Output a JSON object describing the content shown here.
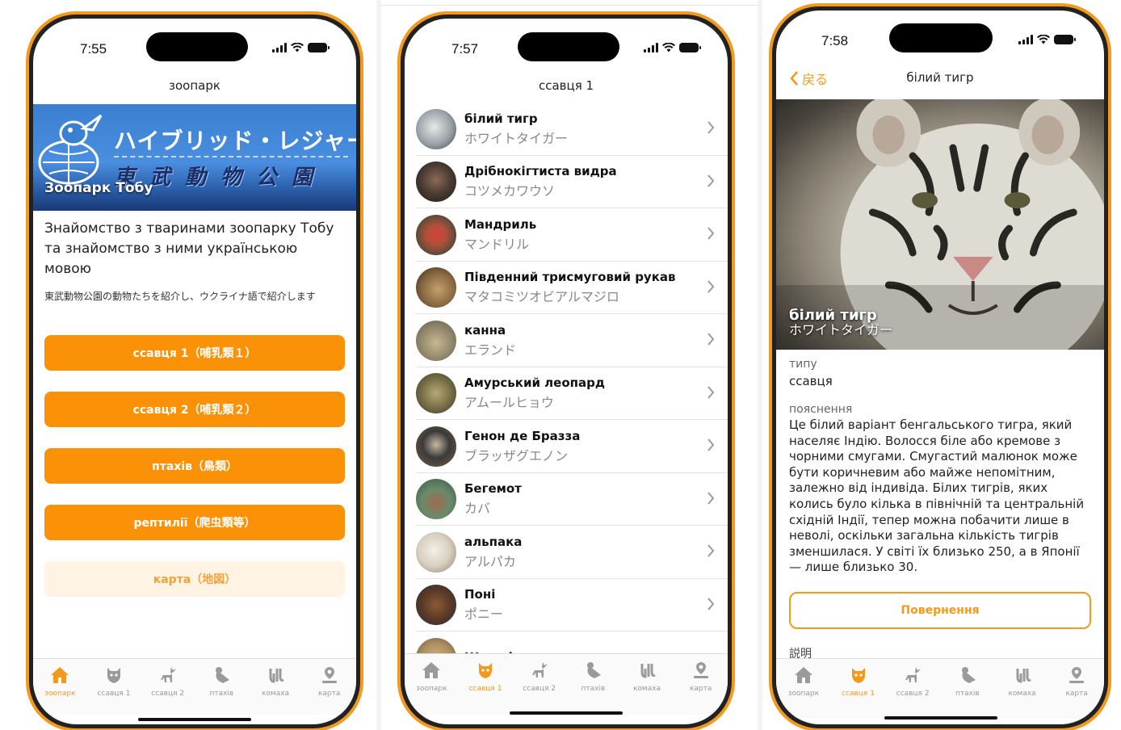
{
  "colors": {
    "accent": "#F39A1E",
    "button": "#FB9106",
    "button_disabled_bg": "#FFF4E3"
  },
  "phone1": {
    "time": "7:55",
    "nav_title": "зоопарк",
    "banner": {
      "jp_line1": "ハイブリッド・レジャーランド",
      "jp_line2": "東武動物公園",
      "caption": "Зоопарк Тобу"
    },
    "intro_uk": "Знайомство з тваринами зоопарку Тобу та знайомство з ними українською мовою",
    "intro_jp": "東武動物公園の動物たちを紹介し、ウクライナ語で紹介します",
    "buttons": [
      {
        "label": "ссавця 1（哺乳類１）"
      },
      {
        "label": "ссавця 2（哺乳類２）"
      },
      {
        "label": "птахів（鳥類）"
      },
      {
        "label": "рептилії（爬虫類等）"
      },
      {
        "label": "карта（地図）"
      }
    ],
    "tabs": [
      {
        "label": "зоопарк",
        "icon": "home-icon",
        "active": true
      },
      {
        "label": "ссавця 1",
        "icon": "mammal-icon",
        "active": false
      },
      {
        "label": "ссавця 2",
        "icon": "deer-icon",
        "active": false
      },
      {
        "label": "птахів",
        "icon": "bird-icon",
        "active": false
      },
      {
        "label": "комаха",
        "icon": "insect-icon",
        "active": false
      },
      {
        "label": "карта",
        "icon": "map-pin-icon",
        "active": false
      }
    ]
  },
  "phone2": {
    "time": "7:57",
    "nav_title": "ссавця 1",
    "animals": [
      {
        "name": "білий тигр",
        "jp": "ホワイトタイガー",
        "color": "#9aa1a6"
      },
      {
        "name": "Дрібнокігтиста видра",
        "jp": "コツメカワウソ",
        "color": "#4a3a32"
      },
      {
        "name": "Мандриль",
        "jp": "マンドリル",
        "color": "#b0503a"
      },
      {
        "name": "Південний трисмуговий рукав",
        "jp": "マタコミツオビアルマジロ",
        "color": "#8a6a44"
      },
      {
        "name": "канна",
        "jp": "エランド",
        "color": "#9a8e72"
      },
      {
        "name": "Амурський леопард",
        "jp": "アムールヒョウ",
        "color": "#7a7048"
      },
      {
        "name": "Генон де Бразза",
        "jp": "ブラッザグエノン",
        "color": "#3a3a3a"
      },
      {
        "name": "Бегемот",
        "jp": "カバ",
        "color": "#6a8a6a"
      },
      {
        "name": "альпака",
        "jp": "アルパカ",
        "color": "#d8d0c0"
      },
      {
        "name": "Поні",
        "jp": "ポニー",
        "color": "#5a3a26"
      },
      {
        "name": "Жираф",
        "jp": "",
        "color": "#b09060"
      }
    ],
    "tabs": [
      {
        "label": "зоопарк",
        "icon": "home-icon",
        "active": false
      },
      {
        "label": "ссавця 1",
        "icon": "mammal-icon",
        "active": true
      },
      {
        "label": "ссавця 2",
        "icon": "deer-icon",
        "active": false
      },
      {
        "label": "птахів",
        "icon": "bird-icon",
        "active": false
      },
      {
        "label": "комаха",
        "icon": "insect-icon",
        "active": false
      },
      {
        "label": "карта",
        "icon": "map-pin-icon",
        "active": false
      }
    ]
  },
  "phone3": {
    "time": "7:58",
    "back_label": "戻る",
    "nav_title": "білий тигр",
    "hero_title": "білий тигр",
    "hero_sub": "ホワイトタイガー",
    "type_label": "типу",
    "type_value": "ссавця",
    "desc_label": "пояснення",
    "description": "Це білий варіант бенгальського тигра, який населяє Індію. Волосся біле або кремове з чорними смугами. Смугастий малюнок може бути коричневим або майже непомітним, залежно від індивіда. Білих тигрів, яких колись було кілька в північній та центральній східній Індії, тепер можна побачити лише в неволі, оскільки загальна кількість тигрів зменшилася. У світі їх близько 250, а в Японії — лише близько 30.",
    "return_button": "Повернення",
    "jp_label": "説明",
    "tabs": [
      {
        "label": "зоопарк",
        "icon": "home-icon",
        "active": false
      },
      {
        "label": "ссавця 1",
        "icon": "mammal-icon",
        "active": true
      },
      {
        "label": "ссавця 2",
        "icon": "deer-icon",
        "active": false
      },
      {
        "label": "птахів",
        "icon": "bird-icon",
        "active": false
      },
      {
        "label": "комаха",
        "icon": "insect-icon",
        "active": false
      },
      {
        "label": "карта",
        "icon": "map-pin-icon",
        "active": false
      }
    ]
  }
}
